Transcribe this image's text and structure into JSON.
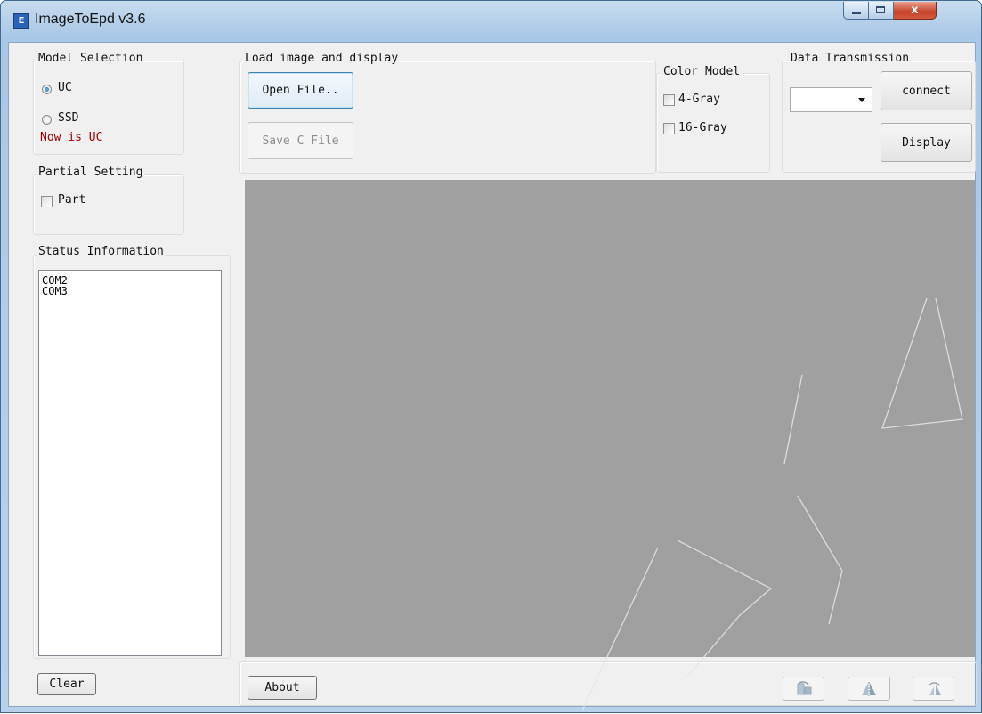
{
  "window": {
    "title": "ImageToEpd v3.6",
    "icon_name": "app-icon",
    "controls": {
      "minimize": "minimize-icon",
      "maximize": "maximize-icon",
      "close_glyph": "x"
    }
  },
  "model_selection": {
    "title": "Model Selection",
    "options": [
      {
        "label": "UC",
        "selected": true
      },
      {
        "label": "SSD",
        "selected": false
      }
    ],
    "status": "Now is UC",
    "status_color": "#a00000"
  },
  "partial_setting": {
    "title": "Partial Setting",
    "part_label": "Part",
    "part_checked": false
  },
  "status_information": {
    "title": "Status Information",
    "lines": [
      "COM2",
      "COM3"
    ]
  },
  "load_image": {
    "title": "Load image and display",
    "open_label": "Open File..",
    "save_label": "Save C File"
  },
  "color_model": {
    "title": "Color Model",
    "options": [
      {
        "label": "4-Gray",
        "checked": false
      },
      {
        "label": "16-Gray",
        "checked": false
      }
    ]
  },
  "data_transmission": {
    "title": "Data Transmission",
    "port_value": "",
    "connect_label": "connect",
    "display_label": "Display"
  },
  "bottom": {
    "clear_label": "Clear",
    "about_label": "About",
    "tools": [
      "rotate-icon",
      "flip-horizontal-icon",
      "flip-vertical-icon"
    ]
  },
  "canvas_color": "#a0a0a0"
}
